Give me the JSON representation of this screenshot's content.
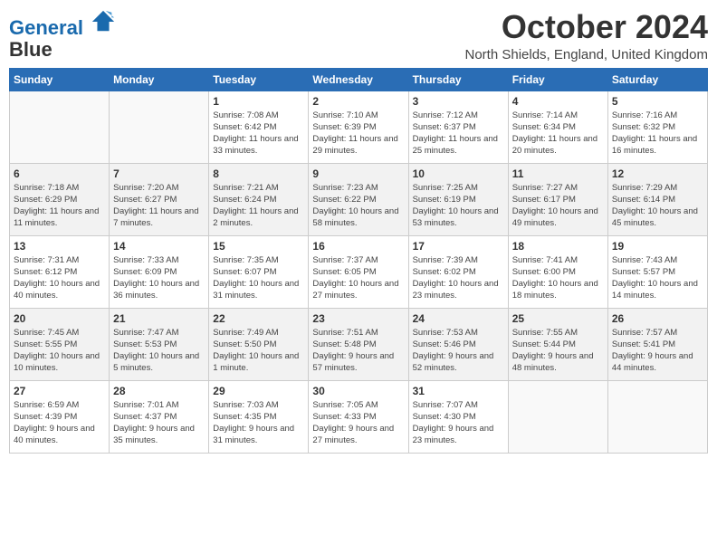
{
  "header": {
    "logo_line1": "General",
    "logo_line2": "Blue",
    "month": "October 2024",
    "location": "North Shields, England, United Kingdom"
  },
  "weekdays": [
    "Sunday",
    "Monday",
    "Tuesday",
    "Wednesday",
    "Thursday",
    "Friday",
    "Saturday"
  ],
  "weeks": [
    [
      {
        "day": "",
        "sunrise": "",
        "sunset": "",
        "daylight": ""
      },
      {
        "day": "",
        "sunrise": "",
        "sunset": "",
        "daylight": ""
      },
      {
        "day": "1",
        "sunrise": "Sunrise: 7:08 AM",
        "sunset": "Sunset: 6:42 PM",
        "daylight": "Daylight: 11 hours and 33 minutes."
      },
      {
        "day": "2",
        "sunrise": "Sunrise: 7:10 AM",
        "sunset": "Sunset: 6:39 PM",
        "daylight": "Daylight: 11 hours and 29 minutes."
      },
      {
        "day": "3",
        "sunrise": "Sunrise: 7:12 AM",
        "sunset": "Sunset: 6:37 PM",
        "daylight": "Daylight: 11 hours and 25 minutes."
      },
      {
        "day": "4",
        "sunrise": "Sunrise: 7:14 AM",
        "sunset": "Sunset: 6:34 PM",
        "daylight": "Daylight: 11 hours and 20 minutes."
      },
      {
        "day": "5",
        "sunrise": "Sunrise: 7:16 AM",
        "sunset": "Sunset: 6:32 PM",
        "daylight": "Daylight: 11 hours and 16 minutes."
      }
    ],
    [
      {
        "day": "6",
        "sunrise": "Sunrise: 7:18 AM",
        "sunset": "Sunset: 6:29 PM",
        "daylight": "Daylight: 11 hours and 11 minutes."
      },
      {
        "day": "7",
        "sunrise": "Sunrise: 7:20 AM",
        "sunset": "Sunset: 6:27 PM",
        "daylight": "Daylight: 11 hours and 7 minutes."
      },
      {
        "day": "8",
        "sunrise": "Sunrise: 7:21 AM",
        "sunset": "Sunset: 6:24 PM",
        "daylight": "Daylight: 11 hours and 2 minutes."
      },
      {
        "day": "9",
        "sunrise": "Sunrise: 7:23 AM",
        "sunset": "Sunset: 6:22 PM",
        "daylight": "Daylight: 10 hours and 58 minutes."
      },
      {
        "day": "10",
        "sunrise": "Sunrise: 7:25 AM",
        "sunset": "Sunset: 6:19 PM",
        "daylight": "Daylight: 10 hours and 53 minutes."
      },
      {
        "day": "11",
        "sunrise": "Sunrise: 7:27 AM",
        "sunset": "Sunset: 6:17 PM",
        "daylight": "Daylight: 10 hours and 49 minutes."
      },
      {
        "day": "12",
        "sunrise": "Sunrise: 7:29 AM",
        "sunset": "Sunset: 6:14 PM",
        "daylight": "Daylight: 10 hours and 45 minutes."
      }
    ],
    [
      {
        "day": "13",
        "sunrise": "Sunrise: 7:31 AM",
        "sunset": "Sunset: 6:12 PM",
        "daylight": "Daylight: 10 hours and 40 minutes."
      },
      {
        "day": "14",
        "sunrise": "Sunrise: 7:33 AM",
        "sunset": "Sunset: 6:09 PM",
        "daylight": "Daylight: 10 hours and 36 minutes."
      },
      {
        "day": "15",
        "sunrise": "Sunrise: 7:35 AM",
        "sunset": "Sunset: 6:07 PM",
        "daylight": "Daylight: 10 hours and 31 minutes."
      },
      {
        "day": "16",
        "sunrise": "Sunrise: 7:37 AM",
        "sunset": "Sunset: 6:05 PM",
        "daylight": "Daylight: 10 hours and 27 minutes."
      },
      {
        "day": "17",
        "sunrise": "Sunrise: 7:39 AM",
        "sunset": "Sunset: 6:02 PM",
        "daylight": "Daylight: 10 hours and 23 minutes."
      },
      {
        "day": "18",
        "sunrise": "Sunrise: 7:41 AM",
        "sunset": "Sunset: 6:00 PM",
        "daylight": "Daylight: 10 hours and 18 minutes."
      },
      {
        "day": "19",
        "sunrise": "Sunrise: 7:43 AM",
        "sunset": "Sunset: 5:57 PM",
        "daylight": "Daylight: 10 hours and 14 minutes."
      }
    ],
    [
      {
        "day": "20",
        "sunrise": "Sunrise: 7:45 AM",
        "sunset": "Sunset: 5:55 PM",
        "daylight": "Daylight: 10 hours and 10 minutes."
      },
      {
        "day": "21",
        "sunrise": "Sunrise: 7:47 AM",
        "sunset": "Sunset: 5:53 PM",
        "daylight": "Daylight: 10 hours and 5 minutes."
      },
      {
        "day": "22",
        "sunrise": "Sunrise: 7:49 AM",
        "sunset": "Sunset: 5:50 PM",
        "daylight": "Daylight: 10 hours and 1 minute."
      },
      {
        "day": "23",
        "sunrise": "Sunrise: 7:51 AM",
        "sunset": "Sunset: 5:48 PM",
        "daylight": "Daylight: 9 hours and 57 minutes."
      },
      {
        "day": "24",
        "sunrise": "Sunrise: 7:53 AM",
        "sunset": "Sunset: 5:46 PM",
        "daylight": "Daylight: 9 hours and 52 minutes."
      },
      {
        "day": "25",
        "sunrise": "Sunrise: 7:55 AM",
        "sunset": "Sunset: 5:44 PM",
        "daylight": "Daylight: 9 hours and 48 minutes."
      },
      {
        "day": "26",
        "sunrise": "Sunrise: 7:57 AM",
        "sunset": "Sunset: 5:41 PM",
        "daylight": "Daylight: 9 hours and 44 minutes."
      }
    ],
    [
      {
        "day": "27",
        "sunrise": "Sunrise: 6:59 AM",
        "sunset": "Sunset: 4:39 PM",
        "daylight": "Daylight: 9 hours and 40 minutes."
      },
      {
        "day": "28",
        "sunrise": "Sunrise: 7:01 AM",
        "sunset": "Sunset: 4:37 PM",
        "daylight": "Daylight: 9 hours and 35 minutes."
      },
      {
        "day": "29",
        "sunrise": "Sunrise: 7:03 AM",
        "sunset": "Sunset: 4:35 PM",
        "daylight": "Daylight: 9 hours and 31 minutes."
      },
      {
        "day": "30",
        "sunrise": "Sunrise: 7:05 AM",
        "sunset": "Sunset: 4:33 PM",
        "daylight": "Daylight: 9 hours and 27 minutes."
      },
      {
        "day": "31",
        "sunrise": "Sunrise: 7:07 AM",
        "sunset": "Sunset: 4:30 PM",
        "daylight": "Daylight: 9 hours and 23 minutes."
      },
      {
        "day": "",
        "sunrise": "",
        "sunset": "",
        "daylight": ""
      },
      {
        "day": "",
        "sunrise": "",
        "sunset": "",
        "daylight": ""
      }
    ]
  ]
}
